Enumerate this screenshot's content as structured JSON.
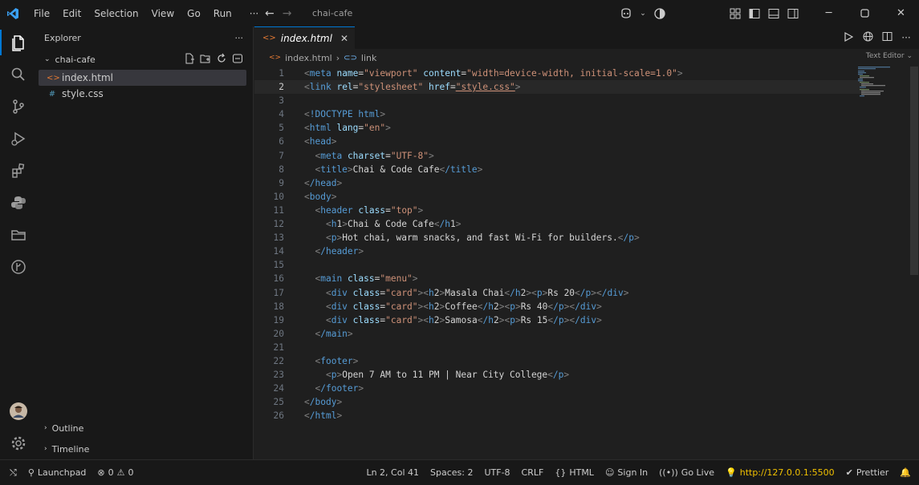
{
  "titlebar": {
    "menu": [
      "File",
      "Edit",
      "Selection",
      "View",
      "Go",
      "Run",
      "···"
    ],
    "title": "chai-cafe"
  },
  "sidebar": {
    "header": "Explorer",
    "more": "···",
    "folder": "chai-cafe",
    "files": [
      {
        "name": "index.html",
        "icon": "html-file-icon",
        "selected": true
      },
      {
        "name": "style.css",
        "icon": "css-file-icon",
        "selected": false
      }
    ],
    "sections": [
      "Outline",
      "Timeline"
    ]
  },
  "editor": {
    "tab": {
      "label": "index.html"
    },
    "breadcrumb": {
      "file": "index.html",
      "symbol": "link"
    },
    "text_editor_label": "Text Editor",
    "current_line": 2,
    "lines": [
      "<meta name=\"viewport\" content=\"width=device-width, initial-scale=1.0\">",
      "<link rel=\"stylesheet\" href=\"style.css\">",
      "",
      "<!DOCTYPE html>",
      "<html lang=\"en\">",
      "<head>",
      "  <meta charset=\"UTF-8\">",
      "  <title>Chai & Code Cafe</title>",
      "</head>",
      "<body>",
      "  <header class=\"top\">",
      "    <h1>Chai & Code Cafe</h1>",
      "    <p>Hot chai, warm snacks, and fast Wi-Fi for builders.</p>",
      "  </header>",
      "",
      "  <main class=\"menu\">",
      "    <div class=\"card\"><h2>Masala Chai</h2><p>Rs 20</p></div>",
      "    <div class=\"card\"><h2>Coffee</h2><p>Rs 40</p></div>",
      "    <div class=\"card\"><h2>Samosa</h2><p>Rs 15</p></div>",
      "  </main>",
      "",
      "  <footer>",
      "    <p>Open 7 AM to 11 PM | Near City College</p>",
      "  </footer>",
      "</body>",
      "</html>"
    ]
  },
  "statusbar": {
    "launchpad": "Launchpad",
    "errors": "0",
    "warnings": "0",
    "position": "Ln 2, Col 41",
    "spaces": "Spaces: 2",
    "encoding": "UTF-8",
    "eol": "CRLF",
    "language": "HTML",
    "sign_in": "Sign In",
    "go_live": "Go Live",
    "server_url": "http://127.0.0.1:5500",
    "prettier": "Prettier"
  },
  "colors": {
    "accent": "#0078d4",
    "tag": "#569cd6",
    "attribute": "#9cdcfe",
    "string": "#ce9178",
    "live_url": "#f0c000"
  }
}
